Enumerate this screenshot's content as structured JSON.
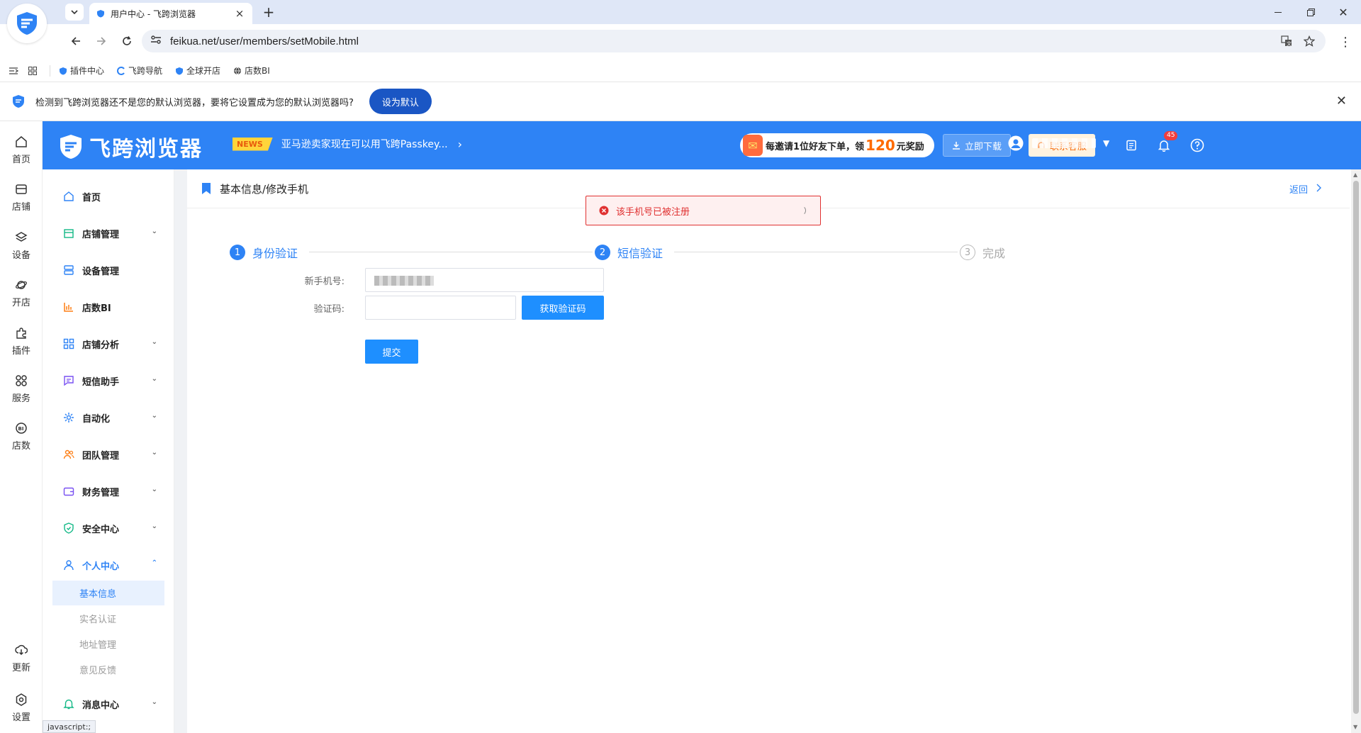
{
  "browser": {
    "tab_title": "用户中心 - 飞跨浏览器",
    "url": "feikua.net/user/members/setMobile.html",
    "bookmarks": [
      "插件中心",
      "飞跨导航",
      "全球开店",
      "店数BI"
    ],
    "infobar_message": "检测到飞跨浏览器还不是您的默认浏览器，要将它设置成为您的默认浏览器吗?",
    "infobar_button": "设为默认",
    "status_text": "javascript:;"
  },
  "rail": {
    "items": [
      "首页",
      "店铺",
      "设备",
      "开店",
      "插件",
      "服务",
      "店数"
    ],
    "bottom": [
      "更新",
      "设置"
    ]
  },
  "header": {
    "brand": "飞跨浏览器",
    "news_tag": "NEWS",
    "news_text": "亚马逊卖家现在可以用飞跨Passkey...",
    "promo_before": "每邀请1位好友下单，领",
    "promo_amount": "120",
    "promo_after": "元奖励",
    "download_label": "立即下载",
    "service_label": "联系客服",
    "notification_count": "45"
  },
  "sidebar": {
    "items": [
      "首页",
      "店铺管理",
      "设备管理",
      "店数BI",
      "店铺分析",
      "短信助手",
      "自动化",
      "团队管理",
      "财务管理",
      "安全中心",
      "个人中心",
      "消息中心"
    ],
    "sub_items": [
      "基本信息",
      "实名认证",
      "地址管理",
      "意见反馈"
    ]
  },
  "main": {
    "breadcrumb": "基本信息/修改手机",
    "back_label": "返回",
    "toast": "该手机号已被注册",
    "steps": [
      {
        "num": "1",
        "label": "身份验证"
      },
      {
        "num": "2",
        "label": "短信验证"
      },
      {
        "num": "3",
        "label": "完成"
      }
    ],
    "form": {
      "phone_label": "新手机号:",
      "code_label": "验证码:",
      "code_value": "",
      "get_code_button": "获取验证码",
      "submit_button": "提交"
    }
  },
  "colors": {
    "primary": "#2e83f5",
    "error": "#e03131",
    "error_bg": "#fef0f0",
    "button": "#1e8fff"
  }
}
